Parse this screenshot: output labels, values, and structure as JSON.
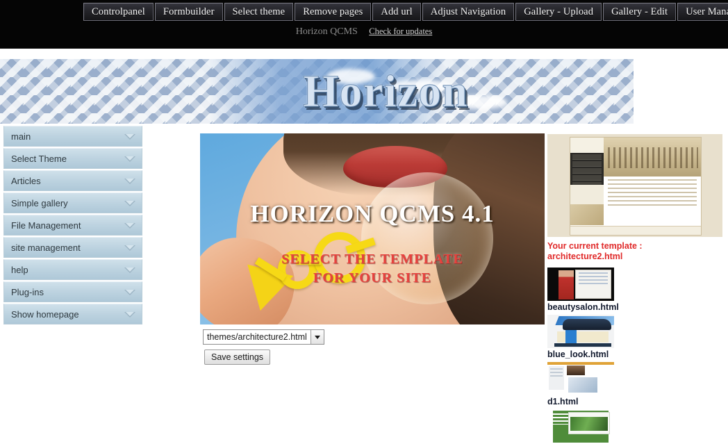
{
  "topbar": {
    "menu": [
      "Controlpanel",
      "Formbuilder",
      "Select theme",
      "Remove pages",
      "Add url",
      "Adjust Navigation",
      "Gallery - Upload",
      "Gallery - Edit",
      "User Manager"
    ],
    "brand": "Horizon QCMS",
    "update_link": "Check for updates"
  },
  "banner": {
    "wordmark": "Horizon"
  },
  "sidebar": {
    "items": [
      {
        "label": "main",
        "icon": "chevron-down-icon"
      },
      {
        "label": "Select Theme",
        "icon": "chevron-down-icon"
      },
      {
        "label": "Articles",
        "icon": "chevron-down-icon"
      },
      {
        "label": "Simple gallery",
        "icon": "chevron-down-icon"
      },
      {
        "label": "File Management",
        "icon": "chevron-down-icon"
      },
      {
        "label": "site management",
        "icon": "chevron-down-icon"
      },
      {
        "label": "help",
        "icon": "chevron-down-icon"
      },
      {
        "label": "Plug-ins",
        "icon": "chevron-down-icon"
      },
      {
        "label": "Show homepage",
        "icon": "chevron-down-icon"
      }
    ]
  },
  "hero": {
    "title": "HORIZON QCMS 4.1",
    "subtitle_line1": "SELECT THE TEMPLATE",
    "subtitle_line2": "FOR YOUR SITE"
  },
  "form": {
    "theme_select_value": "themes/architecture2.html",
    "theme_select_icon": "chevron-down-icon",
    "save_label": "Save settings"
  },
  "right_panel": {
    "current_template_label": "Your current template :",
    "current_template_name": "architecture2.html",
    "templates": [
      {
        "name": "beautysalon.html",
        "art": "t-beauty"
      },
      {
        "name": "blue_look.html",
        "art": "t-blue"
      },
      {
        "name": "d1.html",
        "art": "t-d1"
      },
      {
        "name": "",
        "art": "t-green"
      }
    ]
  },
  "colors": {
    "topbar_bg": "#050505",
    "sidebar_item": "#bdd3e0",
    "accent_red": "#e02a2a",
    "hero_sub_red": "#e8413d",
    "template_name": "#121a2e"
  }
}
